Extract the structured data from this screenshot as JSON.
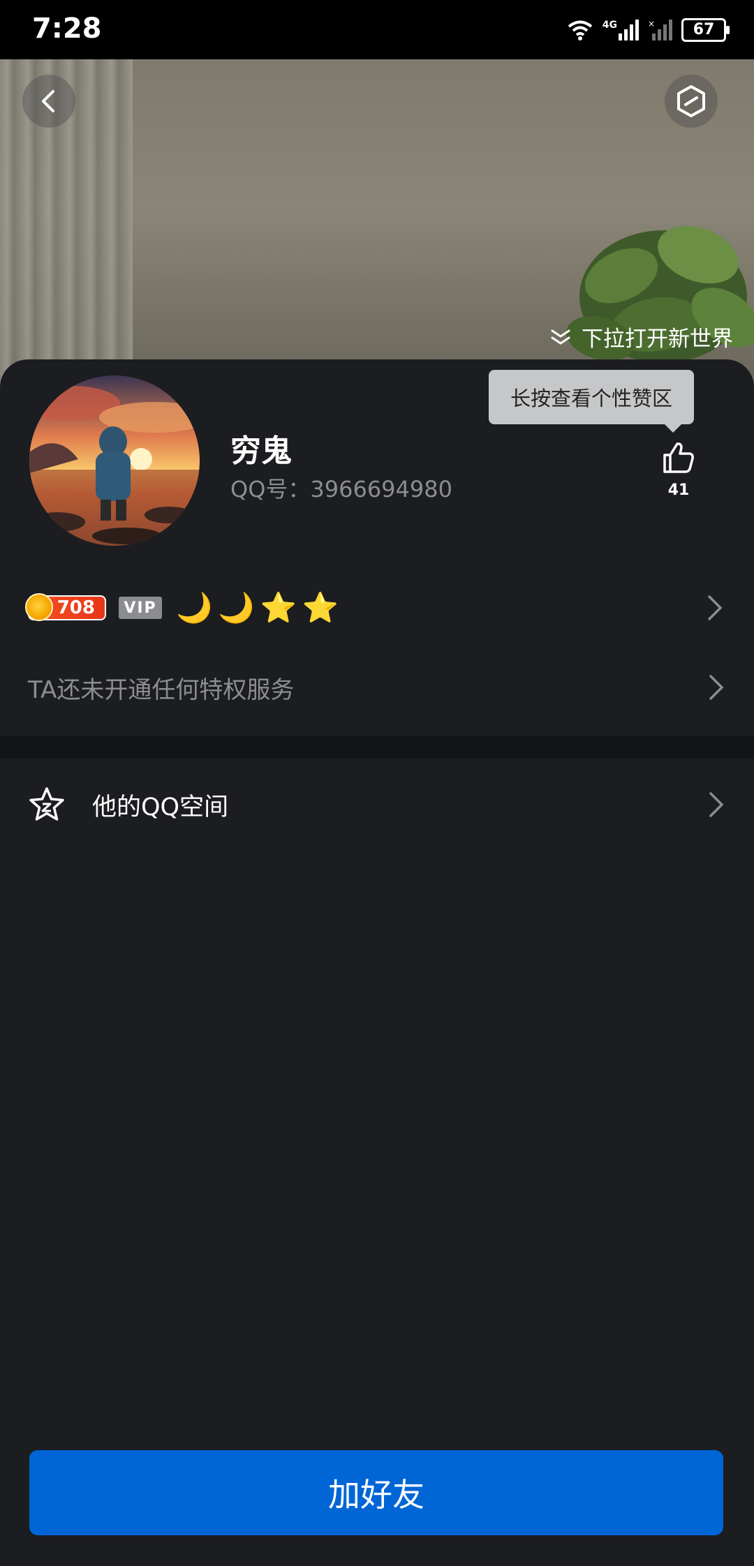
{
  "status_bar": {
    "time": "7:28",
    "network_label": "4G",
    "battery": "67"
  },
  "cover": {
    "pull_hint": "下拉打开新世界"
  },
  "profile": {
    "nickname": "穷鬼",
    "qq_number": "QQ号：3966694980",
    "tooltip": "长按查看个性赞区",
    "likes": "41"
  },
  "badges": {
    "level": "708",
    "vip": "VIP",
    "level_icons": [
      "🌙",
      "🌙",
      "⭐",
      "⭐"
    ]
  },
  "privilege": {
    "text": "TA还未开通任何特权服务"
  },
  "qzone": {
    "label": "他的QQ空间"
  },
  "actions": {
    "add_friend": "加好友"
  },
  "colors": {
    "primary_button": "#0066d6",
    "background": "#1c1d20",
    "secondary_text": "#8c8d91"
  }
}
